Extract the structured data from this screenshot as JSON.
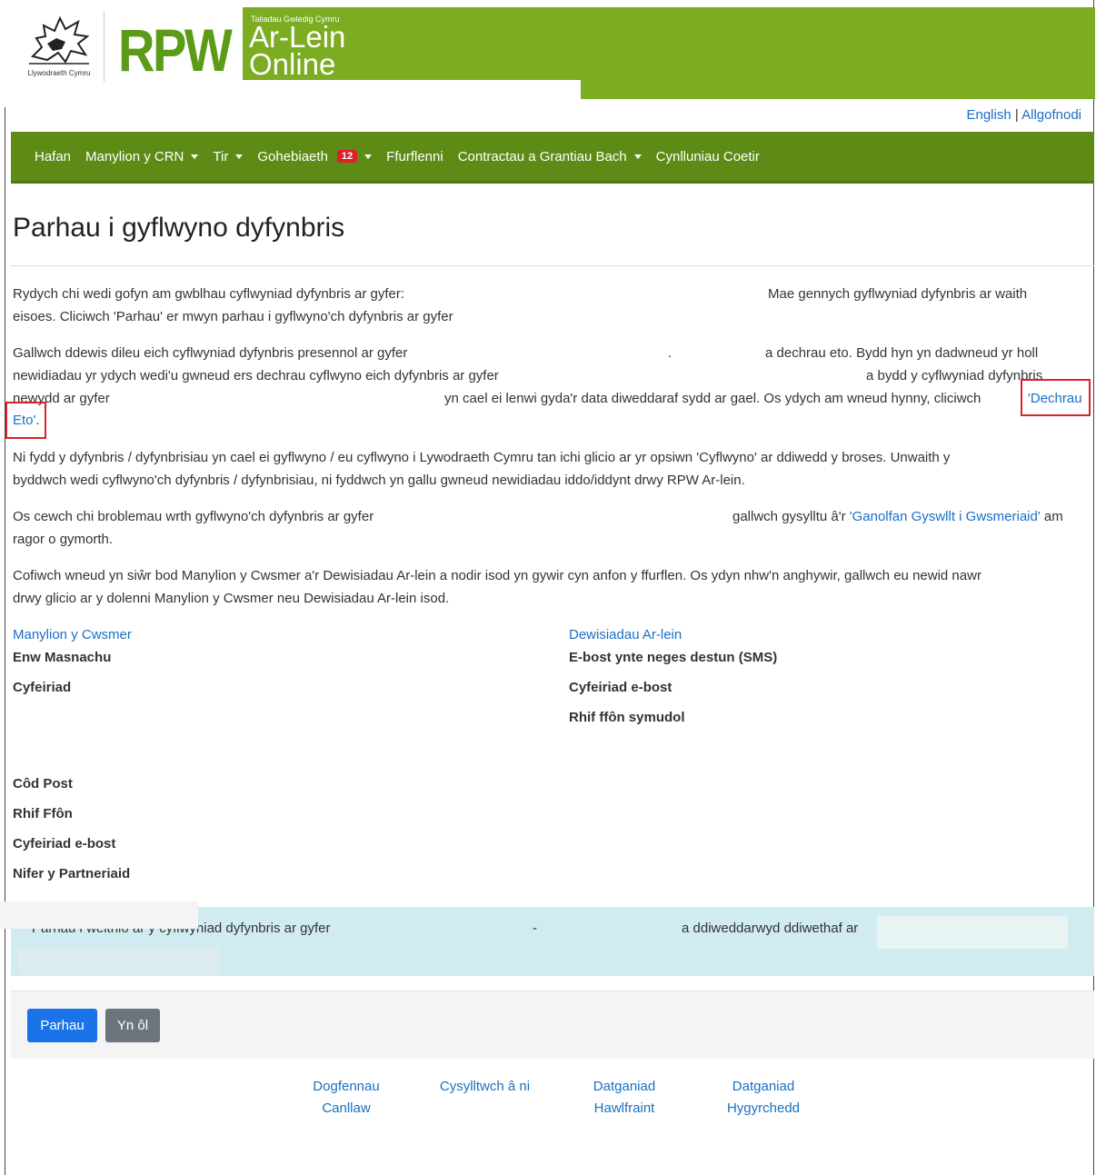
{
  "header": {
    "gov_text": "Llywodraeth Cymru",
    "rpw": "RPW",
    "banner_small": "Taliadau Gwledig Cymru",
    "banner_line1": "Ar-Lein",
    "banner_line2": "Online"
  },
  "top_links": {
    "english": "English",
    "separator": "|",
    "logout": "Allgofnodi"
  },
  "nav": {
    "items": [
      {
        "label": "Hafan"
      },
      {
        "label": "Manylion y CRN"
      },
      {
        "label": "Tir"
      },
      {
        "label": "Gohebiaeth",
        "badge": "12"
      },
      {
        "label": "Ffurflenni"
      },
      {
        "label": "Contractau a Grantiau Bach"
      },
      {
        "label": "Cynlluniau Coetir"
      }
    ]
  },
  "page": {
    "title": "Parhau i gyflwyno dyfynbris",
    "p1_a": "Rydych chi wedi gofyn am gwblhau cyflwyniad dyfynbris ar gyfer:",
    "p1_b": "Mae gennych gyflwyniad dyfynbris ar waith",
    "p1_c": "eisoes. Cliciwch 'Parhau' er mwyn parhau i gyflwyno'ch dyfynbris ar gyfer",
    "p2_a": "Gallwch ddewis dileu eich cyflwyniad dyfynbris presennol ar gyfer",
    "p2_dot": ".",
    "p2_b": "a dechrau eto. Bydd hyn yn dadwneud yr holl",
    "p2_c": "newidiadau yr ydych wedi'u gwneud ers dechrau cyflwyno eich dyfynbris ar gyfer",
    "p2_d": "a bydd y cyflwyniad dyfynbris",
    "p2_e": "newydd ar gyfer",
    "p2_f": "yn cael ei lenwi gyda'r data diweddaraf sydd ar gael. Os ydych am wneud hynny, cliciwch",
    "p2_link1": "'Dechrau",
    "p2_link2": "Eto'",
    "p2_end": ".",
    "p3_a": "Ni fydd y dyfynbris / dyfynbrisiau yn cael ei gyflwyno / eu cyflwyno i Lywodraeth Cymru tan ichi glicio ar yr opsiwn 'Cyflwyno' ar ddiwedd y broses. Unwaith y",
    "p3_b": "byddwch wedi cyflwyno'ch dyfynbris / dyfynbrisiau, ni fyddwch yn gallu gwneud newidiadau iddo/iddynt drwy RPW Ar-lein.",
    "p4_a": "Os cewch chi broblemau wrth gyflwyno'ch dyfynbris ar gyfer",
    "p4_b": "gallwch gysylltu â'r",
    "p4_link": "'Ganolfan Gyswllt i Gwsmeriaid'",
    "p4_c": "am",
    "p4_d": "ragor o gymorth.",
    "p5_a": "Cofiwch wneud yn siŵr bod Manylion y Cwsmer a'r Dewisiadau Ar-lein a nodir isod yn gywir cyn anfon y ffurflen. Os ydyn nhw'n anghywir, gallwch eu newid nawr",
    "p5_b": "drwy glicio ar y dolenni Manylion y Cwsmer neu Dewisiadau Ar-lein isod."
  },
  "customer": {
    "heading": "Manylion y Cwsmer",
    "trading_name": "Enw Masnachu",
    "address": "Cyfeiriad",
    "postcode": "Côd Post",
    "phone": "Rhif Ffôn",
    "email": "Cyfeiriad e-bost",
    "partners": "Nifer y Partneriaid"
  },
  "online": {
    "heading": "Dewisiadau Ar-lein",
    "contact": "E-bost ynte neges destun (SMS)",
    "email": "Cyfeiriad e-bost",
    "mobile": "Rhif ffôn symudol"
  },
  "alert": {
    "text_a": "Parhau i weithio ar y cyflwyniad dyfynbris ar gyfer",
    "dash": "-",
    "text_b": "a ddiweddarwyd ddiwethaf ar"
  },
  "buttons": {
    "continue": "Parhau",
    "back": "Yn ôl"
  },
  "footer": {
    "guidance_1": "Dogfennau",
    "guidance_2": "Canllaw",
    "contact": "Cysylltwch â ni",
    "copyright_1": "Datganiad",
    "copyright_2": "Hawlfraint",
    "accessibility_1": "Datganiad",
    "accessibility_2": "Hygyrchedd"
  },
  "colors": {
    "brand_green": "#7bac22",
    "nav_green": "#5e8b16",
    "link_blue": "#1a6fc4",
    "primary_button": "#1a73e8",
    "alert_bg": "#d1ecf1",
    "highlight_red": "#d9222a"
  }
}
